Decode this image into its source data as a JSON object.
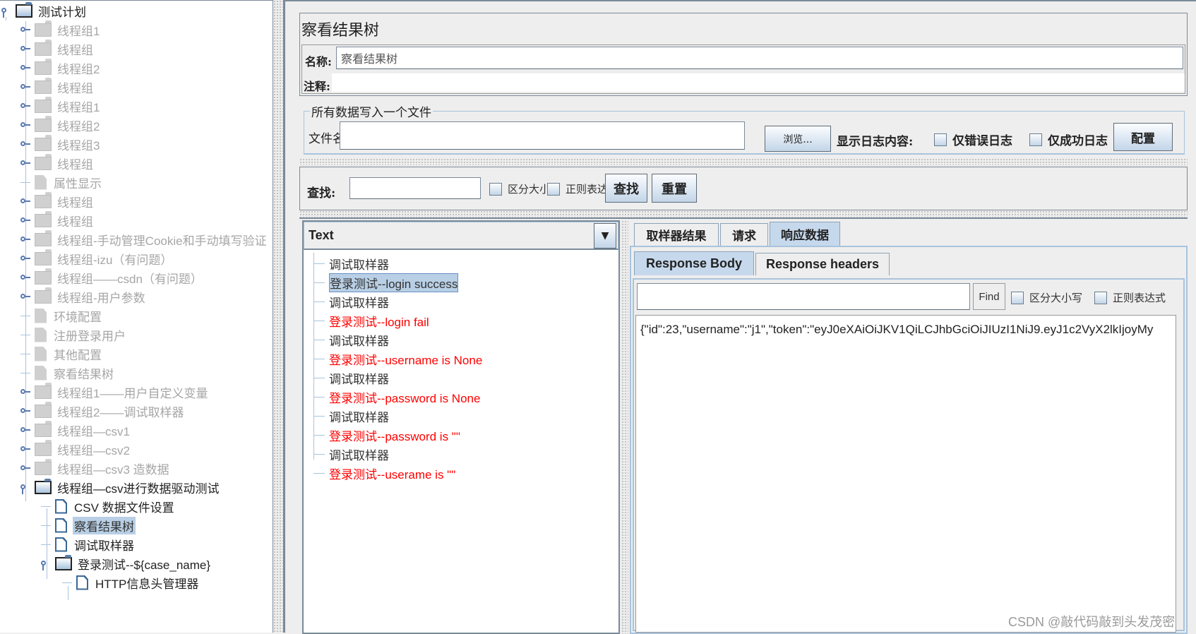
{
  "tree": {
    "root": {
      "label": "测试计划",
      "icon": "folder-open-icon"
    },
    "items": [
      {
        "label": "线程组1",
        "type": "folder",
        "state": "disabled"
      },
      {
        "label": "线程组",
        "type": "folder",
        "state": "disabled"
      },
      {
        "label": "线程组2",
        "type": "folder",
        "state": "disabled"
      },
      {
        "label": "线程组",
        "type": "folder",
        "state": "disabled"
      },
      {
        "label": "线程组1",
        "type": "folder",
        "state": "disabled"
      },
      {
        "label": "线程组2",
        "type": "folder",
        "state": "disabled"
      },
      {
        "label": "线程组3",
        "type": "folder",
        "state": "disabled"
      },
      {
        "label": "线程组",
        "type": "folder",
        "state": "disabled"
      },
      {
        "label": "属性显示",
        "type": "doc",
        "state": "disabled"
      },
      {
        "label": "线程组",
        "type": "folder",
        "state": "disabled"
      },
      {
        "label": "线程组",
        "type": "folder",
        "state": "disabled"
      },
      {
        "label": "线程组-手动管理Cookie和手动填写验证",
        "type": "folder",
        "state": "disabled"
      },
      {
        "label": "线程组-izu（有问题）",
        "type": "folder",
        "state": "disabled"
      },
      {
        "label": "线程组——csdn（有问题）",
        "type": "folder",
        "state": "disabled"
      },
      {
        "label": "线程组-用户参数",
        "type": "folder",
        "state": "disabled"
      },
      {
        "label": "环境配置",
        "type": "doc",
        "state": "disabled"
      },
      {
        "label": "注册登录用户",
        "type": "doc",
        "state": "disabled"
      },
      {
        "label": "其他配置",
        "type": "doc",
        "state": "disabled"
      },
      {
        "label": "察看结果树",
        "type": "doc",
        "state": "disabled"
      },
      {
        "label": "线程组1——用户自定义变量",
        "type": "folder",
        "state": "disabled"
      },
      {
        "label": "线程组2——调试取样器",
        "type": "folder",
        "state": "disabled"
      },
      {
        "label": "线程组—csv1",
        "type": "folder",
        "state": "disabled"
      },
      {
        "label": "线程组—csv2",
        "type": "folder",
        "state": "disabled"
      },
      {
        "label": "线程组—csv3 造数据",
        "type": "folder",
        "state": "disabled"
      },
      {
        "label": "线程组—csv进行数据驱动测试",
        "type": "folder",
        "state": "expanded"
      }
    ],
    "children": [
      {
        "label": "CSV 数据文件设置",
        "type": "doc"
      },
      {
        "label": "察看结果树",
        "type": "doc",
        "selected": true
      },
      {
        "label": "调试取样器",
        "type": "doc"
      },
      {
        "label": "登录测试--${case_name}",
        "type": "folder"
      }
    ],
    "grandchildren": [
      {
        "label": "HTTP信息头管理器",
        "type": "doc"
      }
    ]
  },
  "panel": {
    "title": "察看结果树",
    "name_label": "名称:",
    "name_value": "察看结果树",
    "comment_label": "注释:",
    "comment_value": "",
    "file_group_title": "所有数据写入一个文件",
    "filename_label": "文件名",
    "filename_value": "",
    "browse_button": "浏览...",
    "log_label": "显示日志内容:",
    "errors_only": {
      "label": "仅错误日志",
      "checked": false
    },
    "success_only": {
      "label": "仅成功日志",
      "checked": false
    },
    "configure_button": "配置"
  },
  "search": {
    "label": "查找:",
    "value": "",
    "case_sensitive": {
      "label": "区分大小写",
      "checked": false
    },
    "regex": {
      "label": "正则表达式",
      "checked": false
    },
    "find_button": "查找",
    "reset_button": "重置"
  },
  "results": {
    "renderer": "Text",
    "items": [
      {
        "zh": "调试取样器",
        "en": "",
        "status": "ok"
      },
      {
        "zh": "登录测试",
        "en": "--login success",
        "status": "ok",
        "selected": true
      },
      {
        "zh": "调试取样器",
        "en": "",
        "status": "ok"
      },
      {
        "zh": "登录测试",
        "en": "--login fail",
        "status": "fail"
      },
      {
        "zh": "调试取样器",
        "en": "",
        "status": "ok"
      },
      {
        "zh": "登录测试",
        "en": "--username is None",
        "status": "fail"
      },
      {
        "zh": "调试取样器",
        "en": "",
        "status": "ok"
      },
      {
        "zh": "登录测试",
        "en": "--password is None",
        "status": "fail"
      },
      {
        "zh": "调试取样器",
        "en": "",
        "status": "ok"
      },
      {
        "zh": "登录测试",
        "en": "--password is \"\"",
        "status": "fail"
      },
      {
        "zh": "调试取样器",
        "en": "",
        "status": "ok"
      },
      {
        "zh": "登录测试",
        "en": "--userame is \"\"",
        "status": "fail"
      }
    ]
  },
  "detail": {
    "tabs": [
      {
        "label": "取样器结果",
        "active": false
      },
      {
        "label": "请求",
        "active": false
      },
      {
        "label": "响应数据",
        "active": true
      }
    ],
    "subtabs": [
      {
        "label": "Response Body",
        "active": true
      },
      {
        "label": "Response headers",
        "active": false
      }
    ],
    "find_value": "",
    "find_button": "Find",
    "case_sensitive": {
      "label": "区分大小写",
      "checked": false
    },
    "regex": {
      "label": "正则表达式",
      "checked": false
    },
    "body": "{\"id\":23,\"username\":\"j1\",\"token\":\"eyJ0eXAiOiJKV1QiLCJhbGciOiJIUzI1NiJ9.eyJ1c2VyX2lkIjoyMy"
  },
  "watermark": "CSDN @敲代码敲到头发茂密",
  "colors": {
    "fail": "#ff0000",
    "selection": "#b8cfe5",
    "tab_active": "#c6d8ec"
  }
}
